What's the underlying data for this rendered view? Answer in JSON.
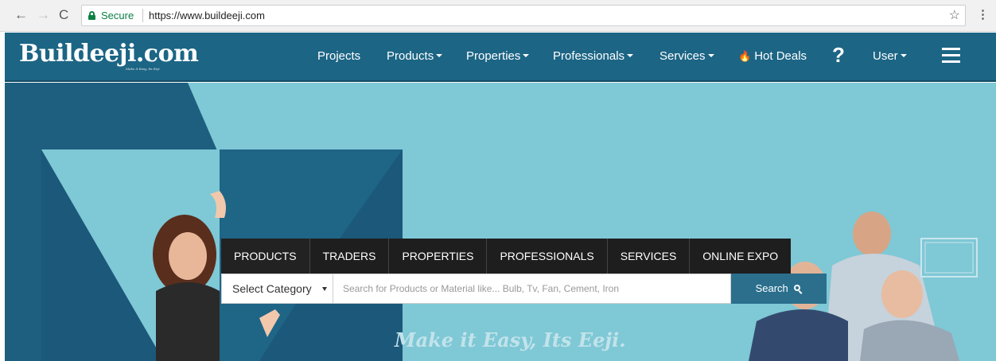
{
  "browser": {
    "back_icon": "←",
    "forward_icon": "→",
    "reload_icon": "C",
    "secure_label": "Secure",
    "url": "https://www.buildeeji.com",
    "star_icon": "☆",
    "menu_icon": "⋮"
  },
  "header": {
    "logo": "Buildeeji.com",
    "tagline": "Make it Easy, Its Eeji",
    "menu": [
      {
        "label": "Projects",
        "dropdown": false
      },
      {
        "label": "Products",
        "dropdown": true
      },
      {
        "label": "Properties",
        "dropdown": true
      },
      {
        "label": "Professionals",
        "dropdown": true
      },
      {
        "label": "Services",
        "dropdown": true
      },
      {
        "label": "Hot Deals",
        "dropdown": false
      },
      {
        "label": "User",
        "dropdown": true
      }
    ],
    "help_icon": "?"
  },
  "search": {
    "tabs": [
      "PRODUCTS",
      "TRADERS",
      "PROPERTIES",
      "PROFESSIONALS",
      "SERVICES",
      "ONLINE EXPO"
    ],
    "category": "Select Category",
    "placeholder": "Search for Products or Material like... Bulb, Tv, Fan, Cement, Iron",
    "button_label": "Search"
  },
  "hero": {
    "slogan": "Make it Easy, Its Eeji."
  },
  "colors": {
    "header_bg": "#1c6585",
    "hero_bg": "#7fc8d6",
    "tabs_bg": "#1e1e1e",
    "search_button": "#2b6f8d",
    "secure_green": "#0b8043"
  }
}
